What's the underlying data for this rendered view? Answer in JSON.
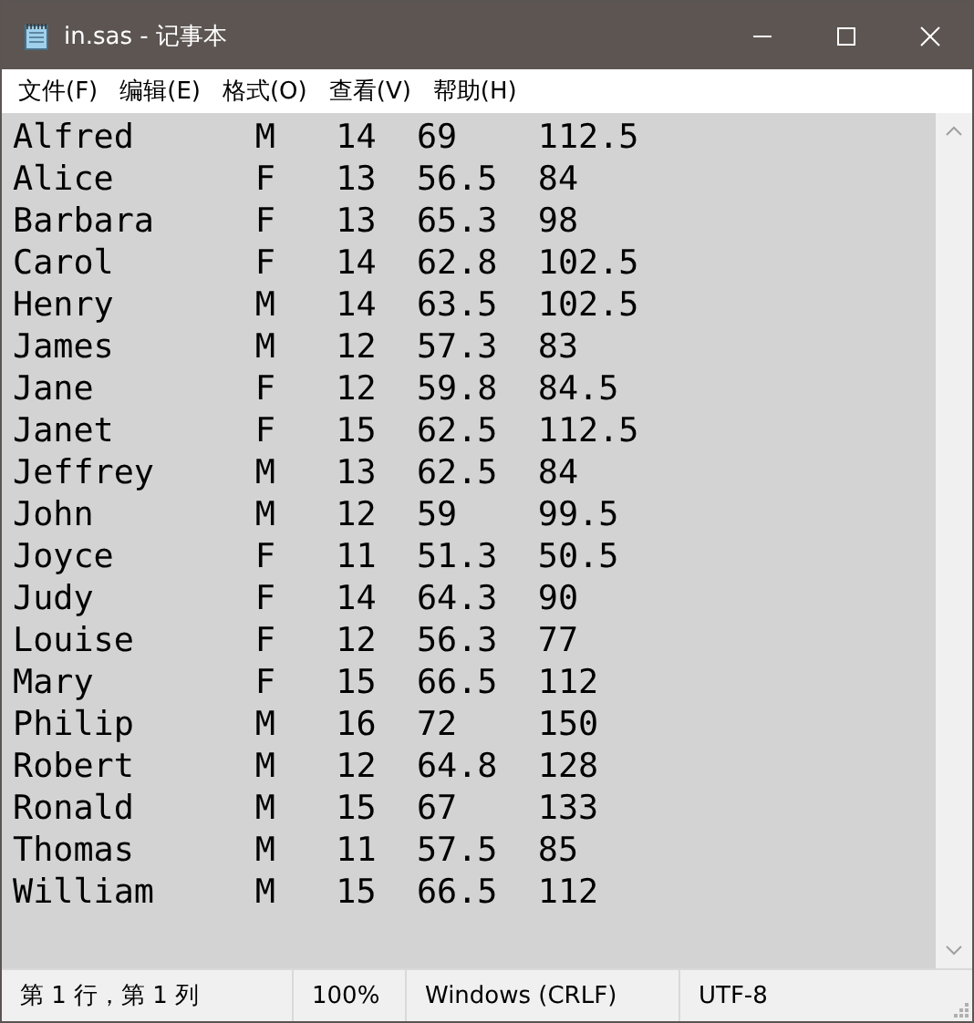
{
  "window": {
    "title": "in.sas - 记事本"
  },
  "menu": [
    "文件(F)",
    "编辑(E)",
    "格式(O)",
    "查看(V)",
    "帮助(H)"
  ],
  "lines": [
    "Alfred      M   14  69    112.5",
    "Alice       F   13  56.5  84",
    "Barbara     F   13  65.3  98",
    "Carol       F   14  62.8  102.5",
    "Henry       M   14  63.5  102.5",
    "James       M   12  57.3  83",
    "Jane        F   12  59.8  84.5",
    "Janet       F   15  62.5  112.5",
    "Jeffrey     M   13  62.5  84",
    "John        M   12  59    99.5",
    "Joyce       F   11  51.3  50.5",
    "Judy        F   14  64.3  90",
    "Louise      F   12  56.3  77",
    "Mary        F   15  66.5  112",
    "Philip      M   16  72    150",
    "Robert      M   12  64.8  128",
    "Ronald      M   15  67    133",
    "Thomas      M   11  57.5  85",
    "William     M   15  66.5  112"
  ],
  "status_bar": [
    "第 1 行，第 1 列",
    "100%",
    "Windows (CRLF)",
    "UTF-8"
  ]
}
